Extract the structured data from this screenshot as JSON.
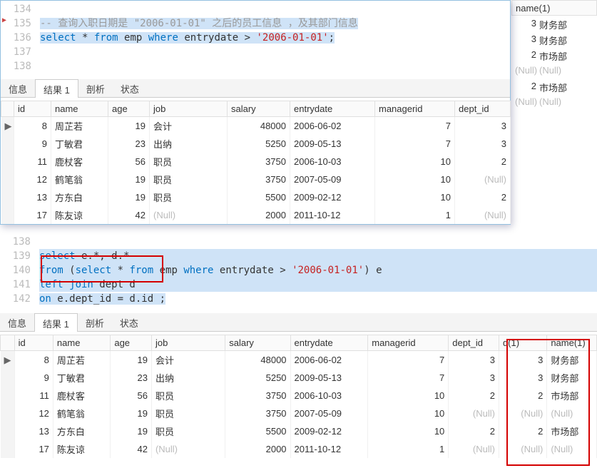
{
  "tabs": {
    "info": "信息",
    "result": "结果 1",
    "profile": "剖析",
    "status": "状态"
  },
  "code1": {
    "l134": {
      "n": "134",
      "t": ""
    },
    "l135": {
      "n": "135",
      "t": "-- 查询入职日期是 \"2006-01-01\" 之后的员工信息 ，及其部门信息"
    },
    "l136": {
      "n": "136",
      "a": "select",
      "b": " * ",
      "c": "from",
      "d": " emp ",
      "e": "where",
      "f": " entrydate > ",
      "g": "'2006-01-01'",
      "h": ";"
    },
    "l137": {
      "n": "137",
      "t": ""
    },
    "l138": {
      "n": "138",
      "t": ""
    }
  },
  "code2": {
    "l138b": {
      "n": "138",
      "t": ""
    },
    "l139": {
      "n": "139",
      "a": "select",
      "b": " e.*, d.*"
    },
    "l140": {
      "n": "140",
      "a": "from",
      "b": " (",
      "c": "select",
      "d": " * ",
      "e": "from",
      "f": " emp ",
      "g": "where",
      "h": " entrydate > ",
      "i": "'2006-01-01'",
      "j": ") e"
    },
    "l141": {
      "n": "141",
      "a": "left join",
      "b": " dept d"
    },
    "l142": {
      "n": "142",
      "a": "on",
      "b": " e.dept_id = d.id ;"
    }
  },
  "hdr1": {
    "id": "id",
    "name": "name",
    "age": "age",
    "job": "job",
    "salary": "salary",
    "entrydate": "entrydate",
    "managerid": "managerid",
    "dept_id": "dept_id"
  },
  "hdr2": {
    "id": "id",
    "name": "name",
    "age": "age",
    "job": "job",
    "salary": "salary",
    "entrydate": "entrydate",
    "managerid": "managerid",
    "dept_id": "dept_id",
    "d1": "d(1)",
    "name1": "name(1)"
  },
  "sideHdr": "name(1)",
  "nulltxt": "(Null)",
  "rows1": [
    {
      "id": "8",
      "name": "周芷若",
      "age": "19",
      "job": "会计",
      "salary": "48000",
      "entrydate": "2006-06-02",
      "managerid": "7",
      "dept_id": "3"
    },
    {
      "id": "9",
      "name": "丁敏君",
      "age": "23",
      "job": "出纳",
      "salary": "5250",
      "entrydate": "2009-05-13",
      "managerid": "7",
      "dept_id": "3"
    },
    {
      "id": "11",
      "name": "鹿杖客",
      "age": "56",
      "job": "职员",
      "salary": "3750",
      "entrydate": "2006-10-03",
      "managerid": "10",
      "dept_id": "2"
    },
    {
      "id": "12",
      "name": "鹤笔翁",
      "age": "19",
      "job": "职员",
      "salary": "3750",
      "entrydate": "2007-05-09",
      "managerid": "10",
      "dept_id": null
    },
    {
      "id": "13",
      "name": "方东白",
      "age": "19",
      "job": "职员",
      "salary": "5500",
      "entrydate": "2009-02-12",
      "managerid": "10",
      "dept_id": "2"
    },
    {
      "id": "17",
      "name": "陈友谅",
      "age": "42",
      "job": null,
      "salary": "2000",
      "entrydate": "2011-10-12",
      "managerid": "1",
      "dept_id": null
    }
  ],
  "rows2": [
    {
      "id": "8",
      "name": "周芷若",
      "age": "19",
      "job": "会计",
      "salary": "48000",
      "entrydate": "2006-06-02",
      "managerid": "7",
      "dept_id": "3",
      "d1": "3",
      "name1": "财务部"
    },
    {
      "id": "9",
      "name": "丁敏君",
      "age": "23",
      "job": "出纳",
      "salary": "5250",
      "entrydate": "2009-05-13",
      "managerid": "7",
      "dept_id": "3",
      "d1": "3",
      "name1": "财务部"
    },
    {
      "id": "11",
      "name": "鹿杖客",
      "age": "56",
      "job": "职员",
      "salary": "3750",
      "entrydate": "2006-10-03",
      "managerid": "10",
      "dept_id": "2",
      "d1": "2",
      "name1": "市场部"
    },
    {
      "id": "12",
      "name": "鹤笔翁",
      "age": "19",
      "job": "职员",
      "salary": "3750",
      "entrydate": "2007-05-09",
      "managerid": "10",
      "dept_id": null,
      "d1": null,
      "name1": null
    },
    {
      "id": "13",
      "name": "方东白",
      "age": "19",
      "job": "职员",
      "salary": "5500",
      "entrydate": "2009-02-12",
      "managerid": "10",
      "dept_id": "2",
      "d1": "2",
      "name1": "市场部"
    },
    {
      "id": "17",
      "name": "陈友谅",
      "age": "42",
      "job": null,
      "salary": "2000",
      "entrydate": "2011-10-12",
      "managerid": "1",
      "dept_id": null,
      "d1": null,
      "name1": null
    }
  ],
  "sideRows": [
    {
      "d1": "3",
      "name1": "财务部"
    },
    {
      "d1": "3",
      "name1": "财务部"
    },
    {
      "d1": "2",
      "name1": "市场部"
    },
    {
      "d1": null,
      "name1": null
    },
    {
      "d1": "2",
      "name1": "市场部"
    },
    {
      "d1": null,
      "name1": null
    }
  ]
}
